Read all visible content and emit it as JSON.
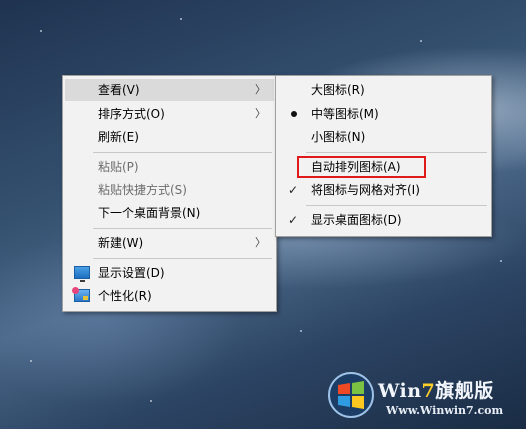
{
  "main_menu": {
    "view": "查看(V)",
    "sort_by": "排序方式(O)",
    "refresh": "刷新(E)",
    "paste": "粘贴(P)",
    "paste_shortcut": "粘贴快捷方式(S)",
    "next_background": "下一个桌面背景(N)",
    "new": "新建(W)",
    "display_settings": "显示设置(D)",
    "personalize": "个性化(R)"
  },
  "view_submenu": {
    "large_icons": "大图标(R)",
    "medium_icons": "中等图标(M)",
    "small_icons": "小图标(N)",
    "auto_arrange": "自动排列图标(A)",
    "align_to_grid": "将图标与网格对齐(I)",
    "show_desktop_icons": "显示桌面图标(D)"
  },
  "glyphs": {
    "submenu_arrow": "〉",
    "check": "✓"
  },
  "watermark": {
    "brand_prefix": "Win",
    "brand_seven": "7",
    "brand_suffix": "旗舰版",
    "url": "Www.Winwin7.com"
  },
  "colors": {
    "highlight_box": "#e0191b",
    "menu_bg": "#f2f2f2",
    "menu_hover": "#dadada"
  }
}
